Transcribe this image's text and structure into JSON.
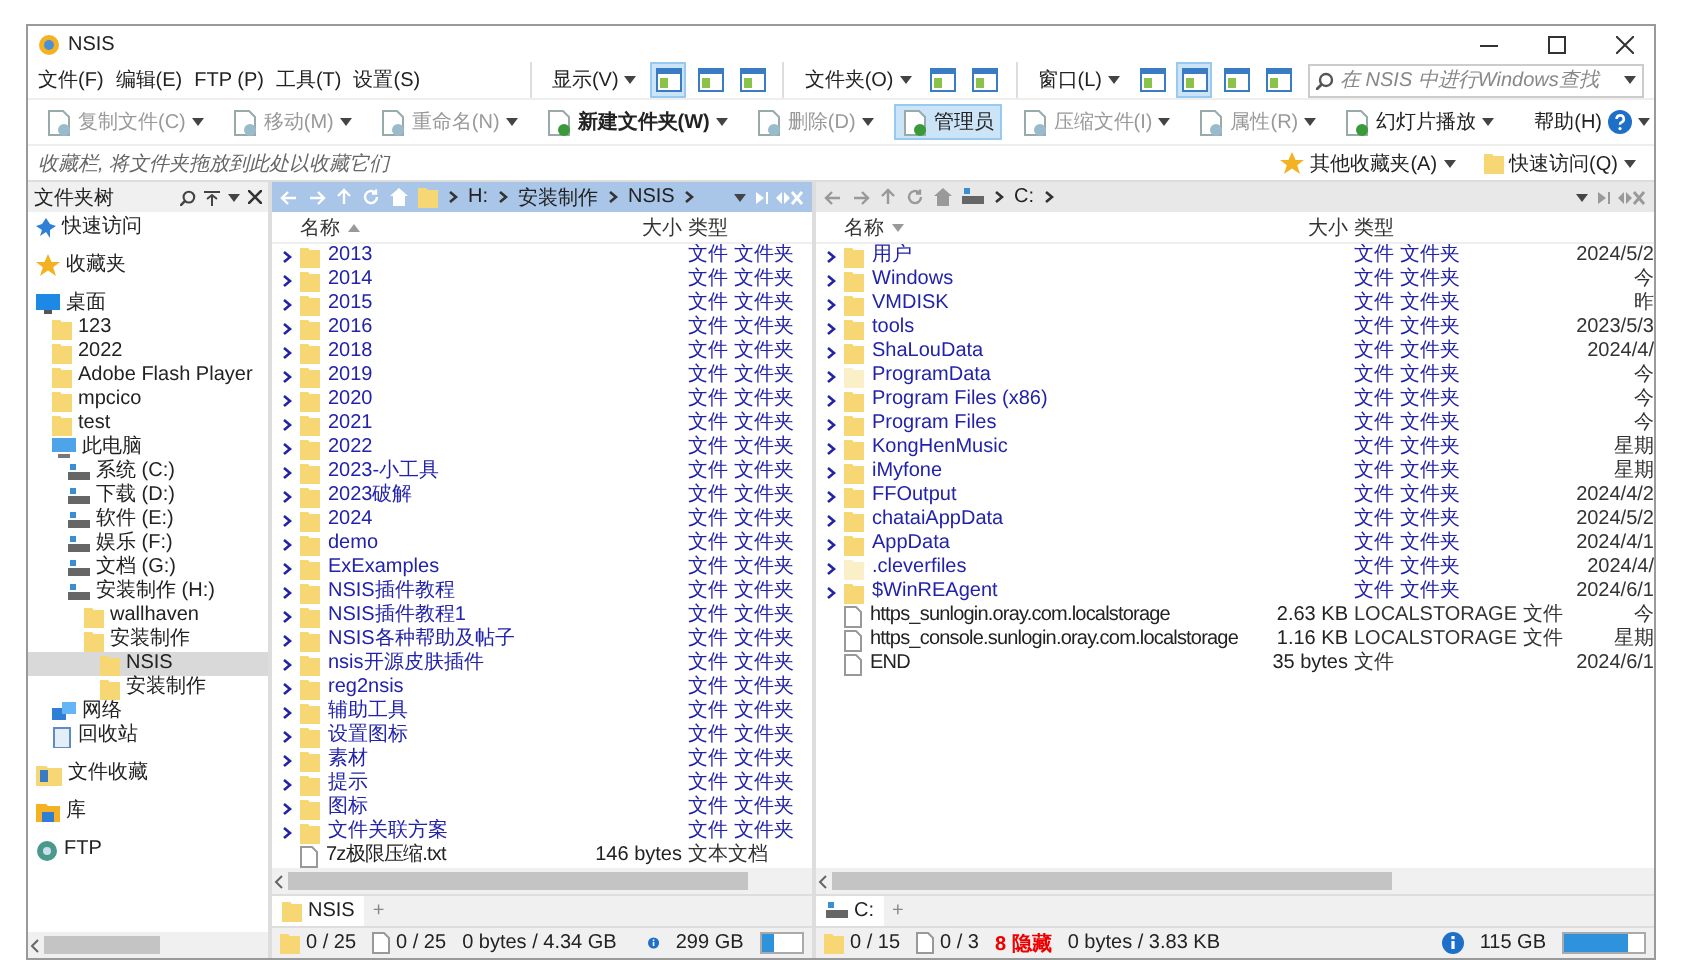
{
  "window": {
    "title": "NSIS"
  },
  "menu": [
    "文件(F)",
    "编辑(E)",
    "FTP (P)",
    "工具(T)",
    "设置(S)"
  ],
  "view_groups": [
    {
      "label": "显示(V)",
      "buttons": [
        {
          "selected": true
        },
        {
          "selected": false
        },
        {
          "selected": false
        }
      ]
    },
    {
      "label": "文件夹(O)",
      "buttons": [
        {
          "selected": false
        },
        {
          "selected": false
        }
      ]
    },
    {
      "label": "窗口(L)",
      "buttons": [
        {
          "selected": false
        },
        {
          "selected": true
        },
        {
          "selected": false
        },
        {
          "selected": false
        }
      ]
    }
  ],
  "search": {
    "placeholder": "在 NSIS 中进行Windows查找"
  },
  "toolbar": [
    {
      "label": "复制文件(C)",
      "disabled": true,
      "selected": false
    },
    {
      "label": "移动(M)",
      "disabled": true,
      "selected": false
    },
    {
      "label": "重命名(N)",
      "disabled": true,
      "selected": false
    },
    {
      "label": "新建文件夹(W)",
      "disabled": false,
      "selected": false
    },
    {
      "label": "删除(D)",
      "disabled": true,
      "selected": false
    },
    {
      "label": "管理员",
      "disabled": false,
      "selected": true
    },
    {
      "label": "压缩文件(I)",
      "disabled": true,
      "selected": false
    },
    {
      "label": "属性(R)",
      "disabled": true,
      "selected": false
    },
    {
      "label": "幻灯片播放",
      "disabled": false,
      "selected": false
    }
  ],
  "help": {
    "label": "帮助(H)"
  },
  "favorites_bar": {
    "hint": "收藏栏, 将文件夹拖放到此处以收藏它们",
    "items": [
      "其他收藏夹(A)",
      "快速访问(Q)"
    ]
  },
  "folder_tree": {
    "title": "文件夹树",
    "items": [
      {
        "label": "快速访问",
        "kind": "pin",
        "selected": false
      },
      {
        "label": "收藏夹",
        "kind": "star",
        "selected": false
      },
      {
        "label": "桌面",
        "kind": "desktop",
        "selected": false,
        "children": [
          {
            "label": "123",
            "kind": "folder",
            "selected": false
          },
          {
            "label": "2022",
            "kind": "folder",
            "selected": false
          },
          {
            "label": "Adobe Flash Player",
            "kind": "folder",
            "selected": false
          },
          {
            "label": "mpcico",
            "kind": "folder",
            "selected": false
          },
          {
            "label": "test",
            "kind": "folder",
            "selected": false
          },
          {
            "label": "此电脑",
            "kind": "pc",
            "selected": false,
            "children": [
              {
                "label": "系统 (C:)",
                "kind": "drive",
                "selected": false
              },
              {
                "label": "下载 (D:)",
                "kind": "drive",
                "selected": false
              },
              {
                "label": "软件 (E:)",
                "kind": "drive",
                "selected": false
              },
              {
                "label": "娱乐 (F:)",
                "kind": "drive",
                "selected": false
              },
              {
                "label": "文档 (G:)",
                "kind": "drive",
                "selected": false
              },
              {
                "label": "安装制作 (H:)",
                "kind": "drive",
                "selected": false,
                "children": [
                  {
                    "label": "wallhaven",
                    "kind": "folder",
                    "selected": false
                  },
                  {
                    "label": "安装制作",
                    "kind": "folder",
                    "selected": false,
                    "children": [
                      {
                        "label": "NSIS",
                        "kind": "folder",
                        "selected": true
                      },
                      {
                        "label": "安装制作",
                        "kind": "folder",
                        "selected": false
                      }
                    ]
                  }
                ]
              }
            ]
          },
          {
            "label": "网络",
            "kind": "network",
            "selected": false
          },
          {
            "label": "回收站",
            "kind": "recycle",
            "selected": false
          }
        ]
      },
      {
        "label": "文件收藏",
        "kind": "collection",
        "selected": false
      },
      {
        "label": "库",
        "kind": "library",
        "selected": false
      },
      {
        "label": "FTP",
        "kind": "ftp",
        "selected": false
      }
    ]
  },
  "panes": [
    {
      "active": true,
      "path": [
        "H:",
        "安装制作",
        "NSIS"
      ],
      "columns": [
        "名称",
        "大小",
        "类型"
      ],
      "rows": [
        {
          "name": "2013",
          "kind": "folder",
          "hidden": false,
          "type": "文件 文件夹"
        },
        {
          "name": "2014",
          "kind": "folder",
          "hidden": false,
          "type": "文件 文件夹"
        },
        {
          "name": "2015",
          "kind": "folder",
          "hidden": false,
          "type": "文件 文件夹"
        },
        {
          "name": "2016",
          "kind": "folder",
          "hidden": false,
          "type": "文件 文件夹"
        },
        {
          "name": "2018",
          "kind": "folder",
          "hidden": false,
          "type": "文件 文件夹"
        },
        {
          "name": "2019",
          "kind": "folder",
          "hidden": false,
          "type": "文件 文件夹"
        },
        {
          "name": "2020",
          "kind": "folder",
          "hidden": false,
          "type": "文件 文件夹"
        },
        {
          "name": "2021",
          "kind": "folder",
          "hidden": false,
          "type": "文件 文件夹"
        },
        {
          "name": "2022",
          "kind": "folder",
          "hidden": false,
          "type": "文件 文件夹"
        },
        {
          "name": "2023-小工具",
          "kind": "folder",
          "hidden": false,
          "type": "文件 文件夹"
        },
        {
          "name": "2023破解",
          "kind": "folder",
          "hidden": false,
          "type": "文件 文件夹"
        },
        {
          "name": "2024",
          "kind": "folder",
          "hidden": false,
          "type": "文件 文件夹"
        },
        {
          "name": "demo",
          "kind": "folder",
          "hidden": false,
          "type": "文件 文件夹"
        },
        {
          "name": "ExExamples",
          "kind": "folder",
          "hidden": false,
          "type": "文件 文件夹"
        },
        {
          "name": "NSIS插件教程",
          "kind": "folder",
          "hidden": false,
          "type": "文件 文件夹"
        },
        {
          "name": "NSIS插件教程1",
          "kind": "folder",
          "hidden": false,
          "type": "文件 文件夹"
        },
        {
          "name": "NSIS各种帮助及帖子",
          "kind": "folder",
          "hidden": false,
          "type": "文件 文件夹"
        },
        {
          "name": "nsis开源皮肤插件",
          "kind": "folder",
          "hidden": false,
          "type": "文件 文件夹"
        },
        {
          "name": "reg2nsis",
          "kind": "folder",
          "hidden": false,
          "type": "文件 文件夹"
        },
        {
          "name": "辅助工具",
          "kind": "folder",
          "hidden": false,
          "type": "文件 文件夹"
        },
        {
          "name": "设置图标",
          "kind": "folder",
          "hidden": false,
          "type": "文件 文件夹"
        },
        {
          "name": "素材",
          "kind": "folder",
          "hidden": false,
          "type": "文件 文件夹"
        },
        {
          "name": "提示",
          "kind": "folder",
          "hidden": false,
          "type": "文件 文件夹"
        },
        {
          "name": "图标",
          "kind": "folder",
          "hidden": false,
          "type": "文件 文件夹"
        },
        {
          "name": "文件关联方案",
          "kind": "folder",
          "hidden": false,
          "type": "文件 文件夹"
        },
        {
          "name": "7z极限压缩.txt",
          "kind": "file",
          "hidden": false,
          "size": "146 bytes",
          "type": "文本文档"
        }
      ],
      "tabs": [
        {
          "label": "NSIS",
          "kind": "folder",
          "selected": true
        }
      ],
      "add_tab": "+",
      "status": {
        "folders": "0 / 25",
        "files": "0 / 25",
        "size": "0 bytes / 4.34 GB",
        "free": "299 GB",
        "level": 0.3
      }
    },
    {
      "active": false,
      "path": [
        "C:"
      ],
      "columns": [
        "名称",
        "大小",
        "类型"
      ],
      "rows": [
        {
          "name": "用户",
          "kind": "folder",
          "hidden": false,
          "type": "文件 文件夹",
          "date": "2024/5/2"
        },
        {
          "name": "Windows",
          "kind": "folder",
          "hidden": false,
          "type": "文件 文件夹",
          "date": "今"
        },
        {
          "name": "VMDISK",
          "kind": "folder",
          "hidden": false,
          "type": "文件 文件夹",
          "date": "昨"
        },
        {
          "name": "tools",
          "kind": "folder",
          "hidden": false,
          "type": "文件 文件夹",
          "date": "2023/5/3"
        },
        {
          "name": "ShaLouData",
          "kind": "folder",
          "hidden": false,
          "type": "文件 文件夹",
          "date": "2024/4/"
        },
        {
          "name": "ProgramData",
          "kind": "folder",
          "hidden": true,
          "type": "文件 文件夹",
          "date": "今"
        },
        {
          "name": "Program Files (x86)",
          "kind": "folder",
          "hidden": false,
          "type": "文件 文件夹",
          "date": "今"
        },
        {
          "name": "Program Files",
          "kind": "folder",
          "hidden": false,
          "type": "文件 文件夹",
          "date": "今"
        },
        {
          "name": "KongHenMusic",
          "kind": "folder",
          "hidden": false,
          "type": "文件 文件夹",
          "date": "星期"
        },
        {
          "name": "iMyfone",
          "kind": "folder",
          "hidden": false,
          "type": "文件 文件夹",
          "date": "星期"
        },
        {
          "name": "FFOutput",
          "kind": "folder",
          "hidden": false,
          "type": "文件 文件夹",
          "date": "2024/4/2"
        },
        {
          "name": "chataiAppData",
          "kind": "folder",
          "hidden": false,
          "type": "文件 文件夹",
          "date": "2024/5/2"
        },
        {
          "name": "AppData",
          "kind": "folder",
          "hidden": false,
          "type": "文件 文件夹",
          "date": "2024/4/1"
        },
        {
          "name": ".cleverfiles",
          "kind": "folder",
          "hidden": true,
          "type": "文件 文件夹",
          "date": "2024/4/"
        },
        {
          "name": "$WinREAgent",
          "kind": "folder",
          "hidden": false,
          "type": "文件 文件夹",
          "date": "2024/6/1"
        },
        {
          "name": "https_sunlogin.oray.com.localstorage",
          "kind": "file",
          "hidden": false,
          "size": "2.63 KB",
          "type": "LOCALSTORAGE 文件",
          "date": "今"
        },
        {
          "name": "https_console.sunlogin.oray.com.localstorage",
          "kind": "file",
          "hidden": false,
          "size": "1.16 KB",
          "type": "LOCALSTORAGE 文件",
          "date": "星期"
        },
        {
          "name": "END",
          "kind": "file",
          "hidden": false,
          "size": "35 bytes",
          "type": "文件",
          "date": "2024/6/1"
        }
      ],
      "tabs": [
        {
          "label": "C:",
          "kind": "drive",
          "selected": true
        }
      ],
      "add_tab": "+",
      "status": {
        "folders": "0 / 15",
        "files": "0 / 3",
        "hidden": "8 隐藏",
        "size": "0 bytes / 3.83 KB",
        "free": "115 GB",
        "level": 0.8
      }
    }
  ]
}
